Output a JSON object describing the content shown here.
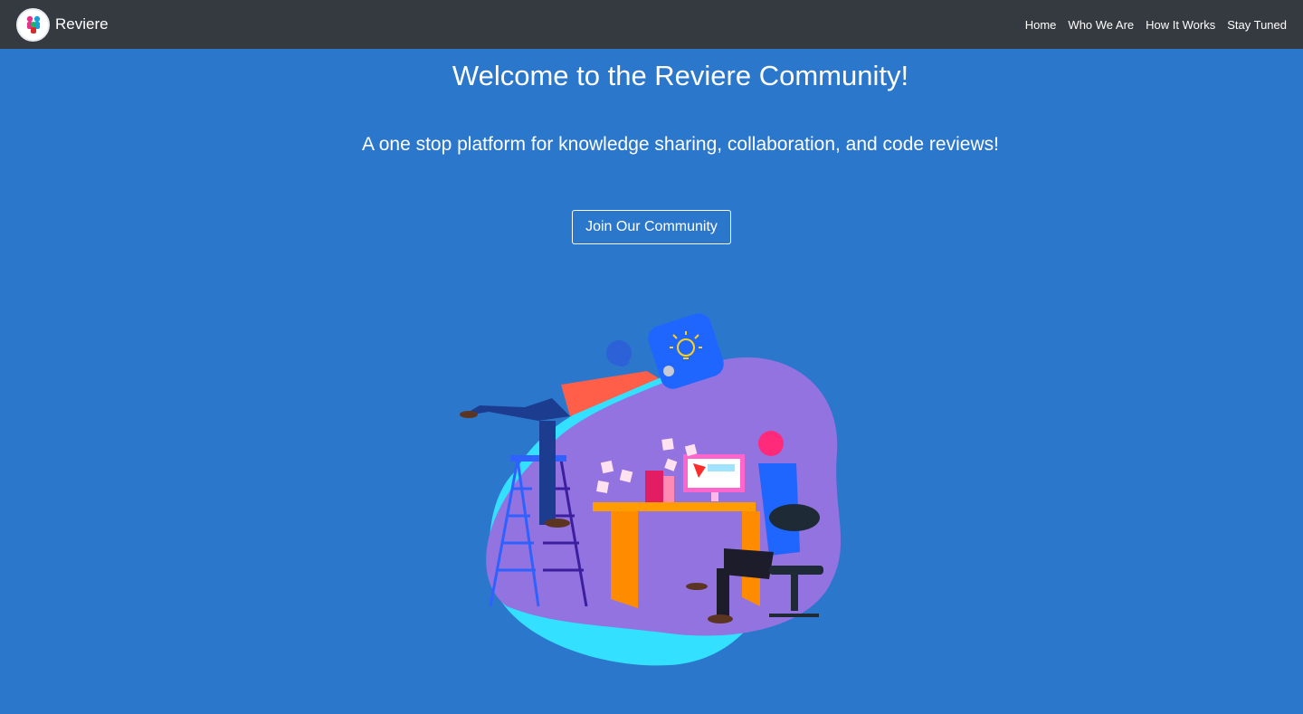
{
  "nav": {
    "brand": "Reviere",
    "links": [
      "Home",
      "Who We Are",
      "How It Works",
      "Stay Tuned"
    ]
  },
  "hero": {
    "title": "Welcome to the Reviere Community!",
    "subtitle": "A one stop platform for knowledge sharing, collaboration, and code reviews!",
    "cta_label": "Join Our Community"
  },
  "colors": {
    "navbar": "#343a40",
    "background": "#2b77cc",
    "text": "#ffffff"
  },
  "icons": [
    "community-logo-icon",
    "lightbulb-icon"
  ]
}
